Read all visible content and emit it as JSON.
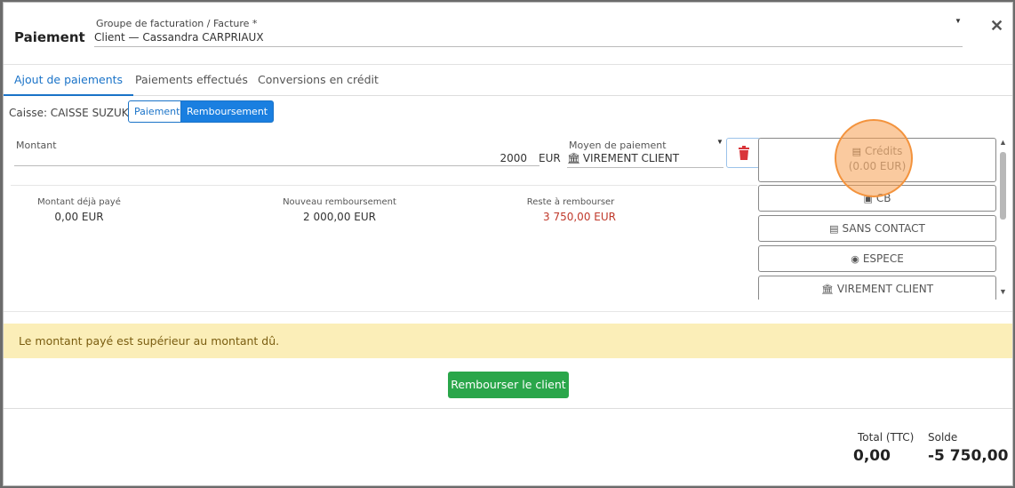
{
  "modal": {
    "title": "Paiement",
    "invoice_label": "Groupe de facturation / Facture *",
    "invoice_value": "Client — Cassandra CARPRIAUX"
  },
  "tabs": [
    {
      "label": "Ajout de paiements",
      "active": true
    },
    {
      "label": "Paiements effectués",
      "active": false
    },
    {
      "label": "Conversions en crédit",
      "active": false
    }
  ],
  "caisse": {
    "label": "Caisse: CAISSE SUZUKI",
    "modes": [
      "Paiement",
      "Remboursement"
    ],
    "selected": "Remboursement"
  },
  "payment_line": {
    "amount_label": "Montant",
    "amount_value": "2000",
    "currency": "EUR",
    "method_label": "Moyen de paiement",
    "method_value": "VIREMENT CLIENT"
  },
  "stats": {
    "already_paid_label": "Montant déjà payé",
    "already_paid_value": "0,00 EUR",
    "new_refund_label": "Nouveau remboursement",
    "new_refund_value": "2 000,00 EUR",
    "remaining_label": "Reste à rembourser",
    "remaining_value": "3 750,00 EUR"
  },
  "payment_methods": {
    "credits_label": "Crédits",
    "credits_amount": "(0.00  EUR)",
    "buttons": [
      "CB",
      "SANS CONTACT",
      "ESPECE",
      "VIREMENT CLIENT"
    ]
  },
  "alert": "Le montant payé est supérieur au montant dû.",
  "refund_button": "Rembourser le client",
  "totals": {
    "total_label": "Total (TTC)",
    "total_value": "0,00",
    "solde_label": "Solde",
    "solde_value": "-5 750,00"
  },
  "colors": {
    "accent": "#1a73c8",
    "danger": "#c0392b",
    "success": "#2aa64a",
    "warning_bg": "#fbeeb8"
  }
}
